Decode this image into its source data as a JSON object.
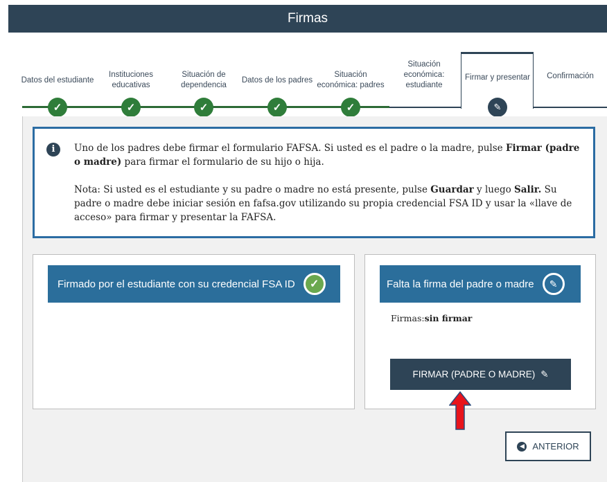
{
  "header": {
    "title": "Firmas"
  },
  "steps": [
    {
      "label": "Datos del estudiante",
      "status": "done"
    },
    {
      "label": "Instituciones educativas",
      "status": "done"
    },
    {
      "label": "Situación de dependencia",
      "status": "done"
    },
    {
      "label": "Datos de los padres",
      "status": "done"
    },
    {
      "label": "Situación económica: padres",
      "status": "done"
    },
    {
      "label": "Situación económica: estudiante",
      "status": "pending"
    },
    {
      "label": "Firmar y presentar",
      "status": "active"
    },
    {
      "label": "Confirmación",
      "status": "pending"
    }
  ],
  "info": {
    "p1_a": "Uno de los padres debe firmar el formulario FAFSA. Si usted es el padre o la madre, pulse ",
    "p1_bold": "Firmar (padre o madre)",
    "p1_b": " para firmar el formulario de su hijo o hija.",
    "p2_a": "Nota: Si usted es el estudiante y su padre o madre no está presente, pulse ",
    "p2_bold1": "Guardar",
    "p2_b": " y luego ",
    "p2_bold2": "Salir.",
    "p2_c": " Su padre o madre debe iniciar sesión en fafsa.gov utilizando su propia credencial FSA ID y usar la «llave de acceso» para firmar y presentar la FAFSA."
  },
  "student_card": {
    "heading": "Firmado por el estudiante con su credencial FSA ID"
  },
  "parent_card": {
    "heading": "Falta la firma del padre o madre",
    "firmas_label": "Firmas:",
    "firmas_value": "sin firmar"
  },
  "buttons": {
    "sign_label": "FIRMAR (PADRE O MADRE)",
    "back_label": "ANTERIOR"
  },
  "colors": {
    "header_bg": "#2e4456",
    "accent_blue": "#2b6e9b",
    "check_green": "#2f7d3a",
    "arrow_red": "#e8141c"
  }
}
